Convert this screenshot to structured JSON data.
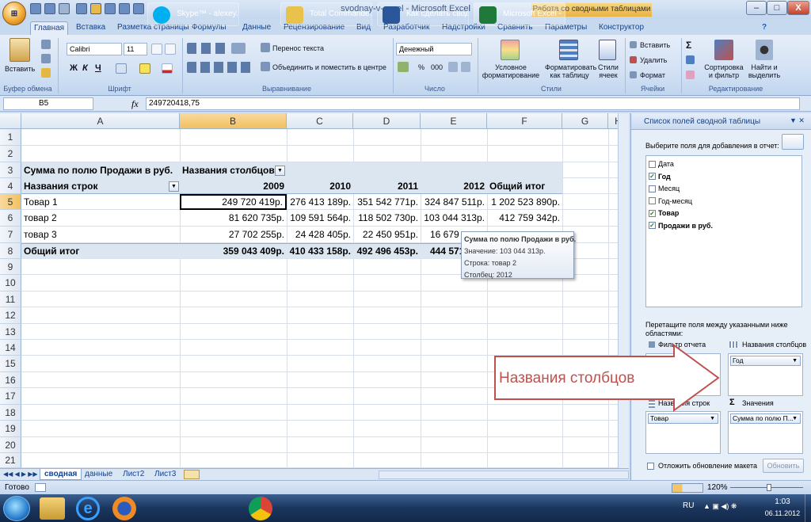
{
  "window": {
    "title": "svodnay-v-excel - Microsoft Excel",
    "context_tools": "Работа со сводными таблицами",
    "minimize": "–",
    "maximize": "□",
    "close": "X"
  },
  "ribbon_tabs": [
    "Главная",
    "Вставка",
    "Разметка страницы",
    "Формулы",
    "Данные",
    "Рецензирование",
    "Вид",
    "Разработчик",
    "Надстройки",
    "Сравнить",
    "Параметры",
    "Конструктор"
  ],
  "ribbon": {
    "clipboard": {
      "paste": "Вставить",
      "group": "Буфер обмена"
    },
    "font": {
      "name": "Calibri",
      "size": "11",
      "bold": "Ж",
      "italic": "К",
      "underline": "Ч",
      "group": "Шрифт"
    },
    "alignment": {
      "wrap": "Перенос текста",
      "merge": "Объединить и поместить в центре",
      "group": "Выравнивание"
    },
    "number": {
      "format": "Денежный",
      "percent": "%",
      "thousands": "000",
      "group": "Число"
    },
    "styles": {
      "conditional": "Условное форматирование",
      "as_table": "Форматировать как таблицу",
      "cell_styles": "Стили ячеек",
      "group": "Стили"
    },
    "cells": {
      "insert": "Вставить",
      "delete": "Удалить",
      "format": "Формат",
      "group": "Ячейки"
    },
    "editing": {
      "sort": "Сортировка и фильтр",
      "find": "Найти и выделить",
      "group": "Редактирование"
    }
  },
  "formula_bar": {
    "name_box": "B5",
    "fx": "fx",
    "value": "249720418,75"
  },
  "columns": [
    "A",
    "B",
    "C",
    "D",
    "E",
    "F",
    "G",
    "H"
  ],
  "rows": [
    "1",
    "2",
    "3",
    "4",
    "5",
    "6",
    "7",
    "8",
    "9",
    "10",
    "11",
    "12",
    "13",
    "14",
    "15",
    "16",
    "17",
    "18",
    "19",
    "20",
    "21"
  ],
  "pivot": {
    "r3": {
      "a": "Сумма по полю Продажи в руб.",
      "b": "Названия столбцов"
    },
    "r4": {
      "a": "Названия строк",
      "b": "2009",
      "c": "2010",
      "d": "2011",
      "e": "2012",
      "f": "Общий итог"
    },
    "r5": {
      "a": "Товар 1",
      "b": "249 720 419р.",
      "c": "276 413 189р.",
      "d": "351 542 771р.",
      "e": "324 847 511р.",
      "f": "1 202 523 890р."
    },
    "r6": {
      "a": "товар 2",
      "b": "81 620 735р.",
      "c": "109 591 564р.",
      "d": "118 502 730р.",
      "e": "103 044 313р.",
      "f": "412 759 342р."
    },
    "r7": {
      "a": "товар 3",
      "b": "27 702 255р.",
      "c": "24 428 405р.",
      "d": "22 450 951р.",
      "e": "16 679"
    },
    "r8": {
      "a": "Общий итог",
      "b": "359 043 409р.",
      "c": "410 433 158р.",
      "d": "492 496 453р.",
      "e": "444 571"
    }
  },
  "tooltip": {
    "title": "Сумма по полю Продажи в руб.",
    "value": "Значение: 103 044 313р.",
    "row": "Строка: товар 2",
    "column": "Столбец: 2012"
  },
  "sheets": {
    "tabs": [
      "сводная",
      "данные",
      "Лист2",
      "Лист3"
    ],
    "active": "сводная"
  },
  "status": {
    "ready": "Готово",
    "zoom": "120%"
  },
  "pane": {
    "title": "Список полей сводной таблицы",
    "choose": "Выберите поля для добавления в отчет:",
    "fields": [
      {
        "label": "Дата",
        "checked": false
      },
      {
        "label": "Год",
        "checked": true
      },
      {
        "label": "Месяц",
        "checked": false
      },
      {
        "label": "Год-месяц",
        "checked": false
      },
      {
        "label": "Товар",
        "checked": true
      },
      {
        "label": "Продажи в руб.",
        "checked": true
      }
    ],
    "drag_hint": "Перетащите поля между указанными ниже областями:",
    "filter_label": "Фильтр отчета",
    "columns_label": "Названия столбцов",
    "columns_value": "Год",
    "rows_label": "Названия строк",
    "rows_value": "Товар",
    "values_label": "Значения",
    "values_value": "Сумма по полю П...",
    "defer": "Отложить обновление макета",
    "update": "Обновить",
    "sigma": "Σ"
  },
  "callout": "Названия столбцов",
  "taskbar": {
    "items": [
      "Skype™ - alexey.b...",
      "Total Commande...",
      "Как сделать свод...",
      "Microsoft Excel - ..."
    ],
    "lang": "RU",
    "time": "1:03",
    "date": "06.11.2012"
  },
  "colors": {
    "accent": "#c0504d",
    "pivot_band": "#dce6f1",
    "selection": "#f1c15f"
  }
}
